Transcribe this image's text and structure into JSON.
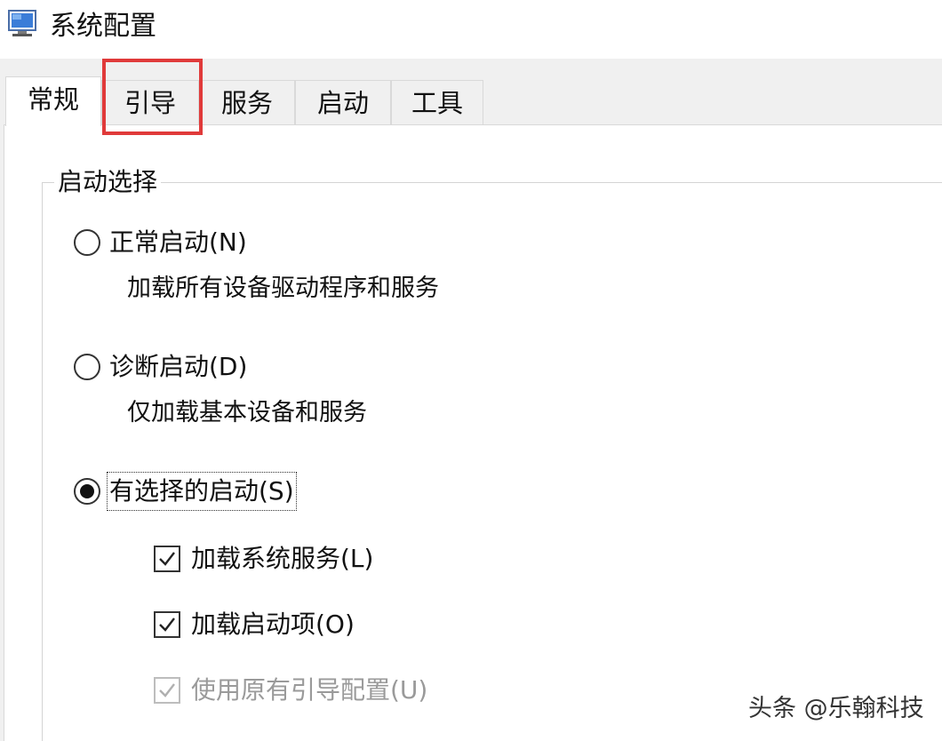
{
  "window": {
    "title": "系统配置",
    "icon": "system-config-app-icon"
  },
  "tabs": [
    {
      "label": "常规",
      "active": true
    },
    {
      "label": "引导",
      "active": false,
      "highlighted": true
    },
    {
      "label": "服务",
      "active": false
    },
    {
      "label": "启动",
      "active": false
    },
    {
      "label": "工具",
      "active": false
    }
  ],
  "startup_selection": {
    "group_label": "启动选择",
    "options": [
      {
        "label": "正常启动(N)",
        "description": "加载所有设备驱动程序和服务",
        "selected": false
      },
      {
        "label": "诊断启动(D)",
        "description": "仅加载基本设备和服务",
        "selected": false
      },
      {
        "label": "有选择的启动(S)",
        "selected": true
      }
    ],
    "selective_items": [
      {
        "label": "加载系统服务(L)",
        "checked": true,
        "enabled": true
      },
      {
        "label": "加载启动项(O)",
        "checked": true,
        "enabled": true
      },
      {
        "label": "使用原有引导配置(U)",
        "checked": true,
        "enabled": false
      }
    ]
  },
  "watermark": "头条 @乐翰科技",
  "colors": {
    "highlight_box": "#e03a3a",
    "panel_background": "#ffffff",
    "window_background": "#f0f0f0"
  }
}
